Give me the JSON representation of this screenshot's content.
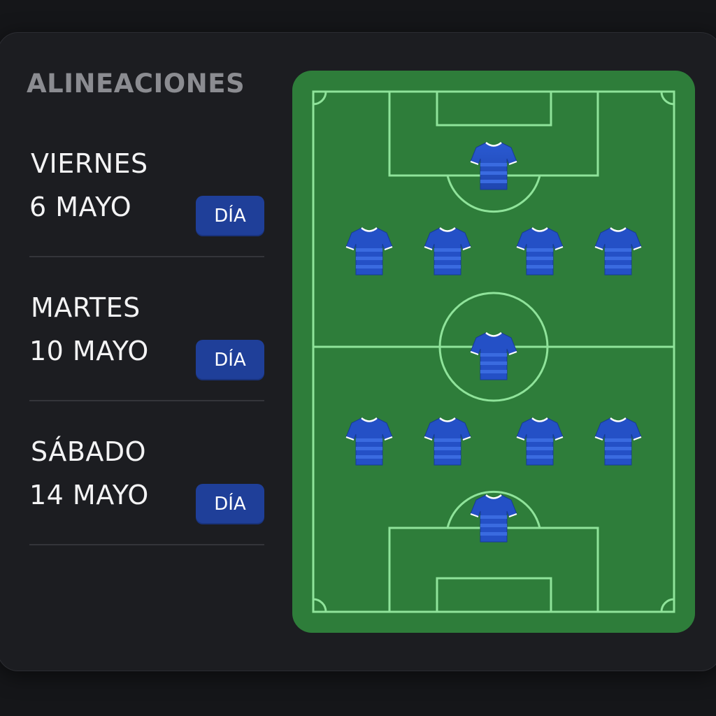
{
  "panel": {
    "title": "ALINEACIONES"
  },
  "matches": [
    {
      "day": "VIERNES",
      "date": "6 MAYO",
      "button_label": "DÍA"
    },
    {
      "day": "MARTES",
      "date": "10 MAYO",
      "button_label": "DÍA"
    },
    {
      "day": "SÁBADO",
      "date": "14 MAYO",
      "button_label": "DÍA"
    }
  ],
  "formation": {
    "players": 11,
    "icon": "shirt-icon"
  },
  "colors": {
    "background": "#151619",
    "panel": "#1c1d21",
    "heading": "#8b8c91",
    "text": "#f3f3f4",
    "button": "#1f3f99",
    "pitch": "#2e7d3a",
    "pitch_lines": "#8fe39a",
    "shirt": "#2350c8"
  }
}
